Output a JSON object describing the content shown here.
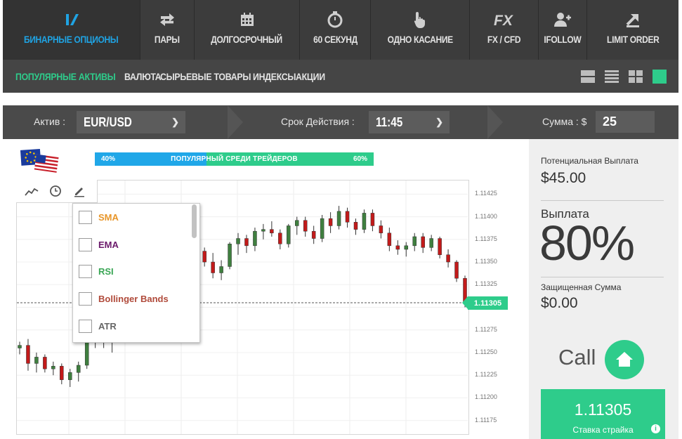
{
  "colors": {
    "accent_blue": "#1fa3e3",
    "accent_green": "#2ecc8b",
    "nav_bg": "#3c3c3c",
    "bull": "#3f7f3f",
    "bear": "#c21a1a"
  },
  "topnav": {
    "tabs": [
      {
        "label": "БИНАРНЫЕ ОПЦИОНЫ",
        "icon": "binary-options-icon",
        "active": true
      },
      {
        "label": "ПАРЫ",
        "icon": "exchange-arrows-icon"
      },
      {
        "label": "ДОЛГОСРОЧНЫЙ",
        "icon": "calendar-icon"
      },
      {
        "label": "60 СЕКУНД",
        "icon": "stopwatch-icon"
      },
      {
        "label": "ОДНО КАСАНИЕ",
        "icon": "pointing-hand-icon"
      },
      {
        "label": "FX / CFD",
        "icon": "fx-text-icon"
      },
      {
        "label": "IFOLLOW",
        "icon": "add-user-icon"
      },
      {
        "label": "LIMIT ORDER",
        "icon": "diagonal-arrow-icon"
      }
    ]
  },
  "subnav": {
    "items": [
      "ПОПУЛЯРНЫЕ АКТИВЫ",
      "ВАЛЮТА",
      "СЫРЬЕВЫЕ ТОВАРЫ",
      "ИНДЕКСЫ",
      "АКЦИИ"
    ],
    "view_icons": [
      "single-view-icon",
      "list-view-icon",
      "grid-view-icon",
      "tile-view-icon"
    ]
  },
  "settings": {
    "asset_label": "Актив :",
    "asset_value": "EUR/USD",
    "expiry_label": "Срок Действия :",
    "expiry_value": "11:45",
    "amount_label": "Сумма : $",
    "amount_value": "25"
  },
  "popularity": {
    "left": "40%",
    "text": "ПОПУЛЯРНЫЙ СРЕДИ ТРЕЙДЕРОВ",
    "right": "60%",
    "left_share": 0.4
  },
  "chart_tools": [
    "line-chart-icon",
    "clock-icon",
    "pencil-icon"
  ],
  "indicators": [
    {
      "label": "SMA",
      "color": "#e8962a",
      "checked": false
    },
    {
      "label": "EMA",
      "color": "#6b1a6b",
      "checked": false
    },
    {
      "label": "RSI",
      "color": "#3aa655",
      "checked": false
    },
    {
      "label": "Bollinger Bands",
      "color": "#b04a3a",
      "checked": false
    },
    {
      "label": "ATR",
      "color": "#666666",
      "checked": false
    }
  ],
  "chart_data": {
    "type": "candlestick",
    "ylim": [
      1.1116,
      1.1144
    ],
    "yticks": [
      "1.11425",
      "1.11400",
      "1.11375",
      "1.11350",
      "1.11325",
      "1.11300",
      "1.11275",
      "1.11250",
      "1.11225",
      "1.11200",
      "1.11175"
    ],
    "current_price": "1.11305",
    "candles": [
      [
        1.11255,
        1.11262,
        1.11248,
        1.11258
      ],
      [
        1.11258,
        1.11265,
        1.1123,
        1.11238
      ],
      [
        1.11238,
        1.1125,
        1.11228,
        1.11245
      ],
      [
        1.11245,
        1.11248,
        1.11228,
        1.11232
      ],
      [
        1.11232,
        1.1124,
        1.11225,
        1.11235
      ],
      [
        1.11235,
        1.11238,
        1.11215,
        1.1122
      ],
      [
        1.1122,
        1.11232,
        1.11212,
        1.11228
      ],
      [
        1.11228,
        1.1124,
        1.11218,
        1.11236
      ],
      [
        1.11236,
        1.11268,
        1.11232,
        1.11265
      ],
      [
        1.11265,
        1.11275,
        1.11255,
        1.1127
      ],
      [
        1.1127,
        1.11278,
        1.11255,
        1.11262
      ],
      [
        1.11262,
        1.11275,
        1.1125,
        1.1127
      ],
      [
        1.1127,
        1.11292,
        1.11265,
        1.11288
      ],
      [
        1.11288,
        1.11295,
        1.1127,
        1.11275
      ],
      [
        1.11275,
        1.113,
        1.11268,
        1.11296
      ],
      [
        1.11296,
        1.11318,
        1.1129,
        1.11315
      ],
      [
        1.11315,
        1.1133,
        1.11305,
        1.1131
      ],
      [
        1.1131,
        1.11322,
        1.1129,
        1.11296
      ],
      [
        1.11296,
        1.1134,
        1.11292,
        1.11334
      ],
      [
        1.11334,
        1.11345,
        1.11326,
        1.11338
      ],
      [
        1.11338,
        1.1136,
        1.11332,
        1.11355
      ],
      [
        1.11355,
        1.11368,
        1.11348,
        1.11362
      ],
      [
        1.11362,
        1.11366,
        1.11345,
        1.1135
      ],
      [
        1.1135,
        1.1136,
        1.11332,
        1.11338
      ],
      [
        1.11338,
        1.11352,
        1.1133,
        1.11345
      ],
      [
        1.11345,
        1.11372,
        1.11342,
        1.1137
      ],
      [
        1.1137,
        1.11382,
        1.11358,
        1.11376
      ],
      [
        1.11376,
        1.1138,
        1.1136,
        1.11368
      ],
      [
        1.11368,
        1.11388,
        1.11362,
        1.11384
      ],
      [
        1.11384,
        1.11392,
        1.11375,
        1.11386
      ],
      [
        1.11386,
        1.11395,
        1.11378,
        1.11382
      ],
      [
        1.11382,
        1.11386,
        1.11364,
        1.1137
      ],
      [
        1.1137,
        1.11392,
        1.11366,
        1.1139
      ],
      [
        1.1139,
        1.114,
        1.1138,
        1.11396
      ],
      [
        1.11396,
        1.114,
        1.11378,
        1.11384
      ],
      [
        1.11384,
        1.1139,
        1.1137,
        1.11376
      ],
      [
        1.11376,
        1.11402,
        1.11372,
        1.11398
      ],
      [
        1.11398,
        1.11405,
        1.11382,
        1.1139
      ],
      [
        1.1139,
        1.11412,
        1.11386,
        1.11406
      ],
      [
        1.11406,
        1.1141,
        1.11388,
        1.11394
      ],
      [
        1.11394,
        1.11398,
        1.1138,
        1.11386
      ],
      [
        1.11386,
        1.11408,
        1.11382,
        1.11404
      ],
      [
        1.11404,
        1.11408,
        1.11384,
        1.1139
      ],
      [
        1.1139,
        1.11396,
        1.11376,
        1.11382
      ],
      [
        1.11382,
        1.11388,
        1.11362,
        1.11368
      ],
      [
        1.11368,
        1.11374,
        1.11358,
        1.11364
      ],
      [
        1.11364,
        1.11372,
        1.11356,
        1.11368
      ],
      [
        1.11368,
        1.11382,
        1.11362,
        1.11378
      ],
      [
        1.11378,
        1.11382,
        1.1136,
        1.11366
      ],
      [
        1.11366,
        1.1138,
        1.11362,
        1.11376
      ],
      [
        1.11376,
        1.11378,
        1.11354,
        1.11358
      ],
      [
        1.11358,
        1.11364,
        1.11344,
        1.1135
      ],
      [
        1.1135,
        1.11352,
        1.11328,
        1.11332
      ],
      [
        1.11332,
        1.11335,
        1.113,
        1.11305
      ]
    ]
  },
  "panel": {
    "potential_label": "Потенциальная Выплата",
    "potential_value": "$45.00",
    "payout_label": "Выплата",
    "payout_value": "80%",
    "protected_label": "Защищенная Сумма",
    "protected_value": "$0.00",
    "call_label": "Call",
    "strike_value": "1.11305",
    "strike_caption": "Ставка страйка",
    "info_glyph": "i"
  }
}
